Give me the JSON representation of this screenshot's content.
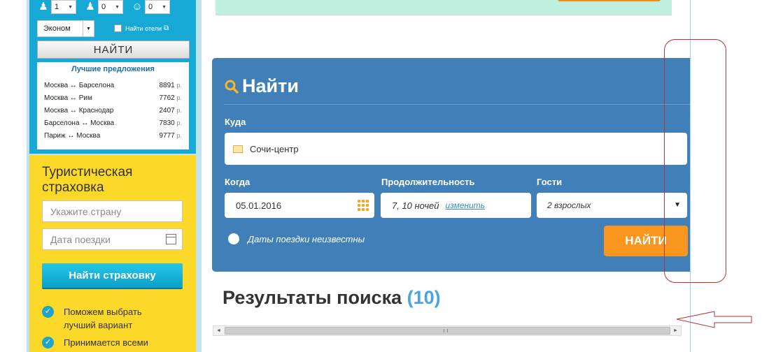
{
  "sidebar": {
    "pax": [
      {
        "icon": "adult-icon",
        "value": "1"
      },
      {
        "icon": "child-icon",
        "value": "0"
      },
      {
        "icon": "infant-icon",
        "value": "0"
      }
    ],
    "class_value": "Эконом",
    "hotels_label": "Найти отели",
    "find_label": "НАЙТИ",
    "best_offers_title": "Лучшие предложения",
    "offers": [
      {
        "route": "Москва ↔ Барселона",
        "price": "8891",
        "currency": "р."
      },
      {
        "route": "Москва ↔ Рим",
        "price": "7762",
        "currency": "р."
      },
      {
        "route": "Москва ↔ Краснодар",
        "price": "2407",
        "currency": "р."
      },
      {
        "route": "Барселона ↔ Москва",
        "price": "7830",
        "currency": "р."
      },
      {
        "route": "Париж ↔ Москва",
        "price": "9777",
        "currency": "р."
      }
    ],
    "insurance": {
      "title_line1": "Туристическая",
      "title_line2": "страховка",
      "country_placeholder": "Укажите страну",
      "date_placeholder": "Дата поездки",
      "button_label": "Найти страховку",
      "benefit1_line1": "Поможем выбрать",
      "benefit1_line2": "лучший вариант",
      "benefit2_line1": "Принимается всеми"
    }
  },
  "search_panel": {
    "title": "Найти",
    "where_label": "Куда",
    "where_value": "Сочи-центр",
    "when_label": "Когда",
    "when_value": "05.01.2016",
    "duration_label": "Продолжительность",
    "duration_value": "7, 10 ночей",
    "duration_change": "изменить",
    "guests_label": "Гости",
    "guests_value": "2 взрослых",
    "unknown_dates_label": "Даты поездки неизвестны",
    "find_label": "НАЙТИ"
  },
  "results": {
    "title": "Результаты поиска",
    "count": "(10)"
  },
  "colors": {
    "panel_blue": "#407fb8",
    "accent_orange": "#f8961d",
    "sidebar_blue": "#17a9d6",
    "insurance_yellow": "#fcd828",
    "annotation_red": "#b63434"
  }
}
